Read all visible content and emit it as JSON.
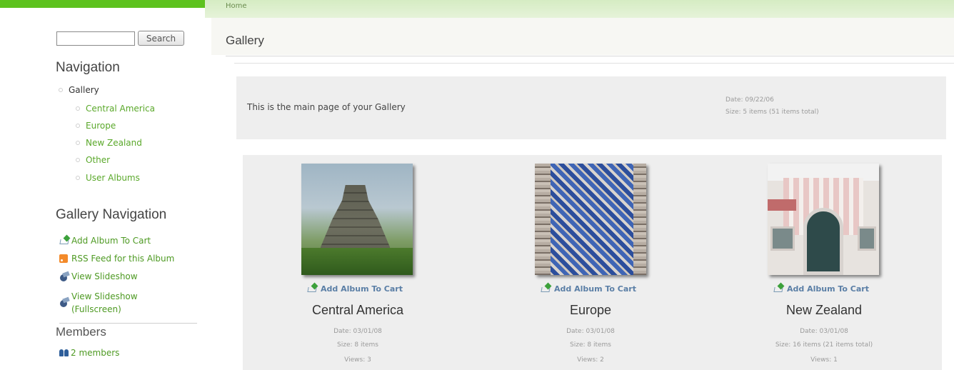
{
  "sidebar": {
    "search": {
      "placeholder": "",
      "value": "",
      "button_label": "Search"
    },
    "navigation": {
      "heading": "Navigation",
      "root": "Gallery",
      "items": [
        "Central America",
        "Europe",
        "New Zealand",
        "Other",
        "User Albums"
      ]
    },
    "gallery_navigation": {
      "heading": "Gallery Navigation",
      "items": [
        {
          "label": "Add Album To Cart",
          "icon": "cart-icon"
        },
        {
          "label": "RSS Feed for this Album",
          "icon": "rss-icon"
        },
        {
          "label": "View Slideshow",
          "icon": "slideshow-icon"
        },
        {
          "label": "View Slideshow (Fullscreen)",
          "line1": "View Slideshow",
          "line2": "(Fullscreen)",
          "icon": "slideshow-fullscreen-icon"
        }
      ]
    },
    "members": {
      "heading": "Members",
      "count_label": "2 members",
      "icon": "members-icon"
    }
  },
  "main": {
    "breadcrumb": "Home",
    "title": "Gallery",
    "description": {
      "text": "This is the main page of your Gallery",
      "date": "Date: 09/22/06",
      "size": "Size: 5 items (51 items total)"
    },
    "albums": [
      {
        "title": "Central America",
        "cart_label": "Add Album To Cart",
        "date": "Date: 03/01/08",
        "size": "Size: 8 items",
        "views": "Views: 3"
      },
      {
        "title": "Europe",
        "cart_label": "Add Album To Cart",
        "date": "Date: 03/01/08",
        "size": "Size: 8 items",
        "views": "Views: 2"
      },
      {
        "title": "New Zealand",
        "cart_label": "Add Album To Cart",
        "date": "Date: 03/01/08",
        "size": "Size: 16 items (21 items total)",
        "views": "Views: 1"
      }
    ]
  },
  "colors": {
    "accent_green": "#5dc21e",
    "link_green": "#4e9a23",
    "cart_link_blue": "#5b7fa6"
  }
}
